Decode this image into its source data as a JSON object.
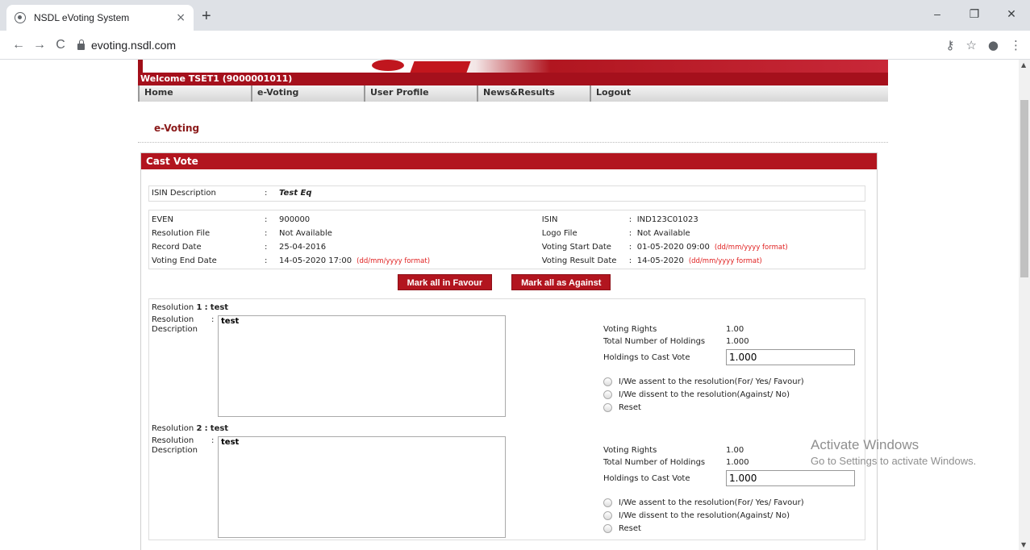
{
  "browser": {
    "tab_title": "NSDL eVoting System",
    "tab_close": "×",
    "new_tab": "+",
    "minimize": "–",
    "restore": "❐",
    "close": "✕",
    "back": "←",
    "forward": "→",
    "reload": "C",
    "url": "evoting.nsdl.com",
    "key_icon": "⚷",
    "star_icon": "☆",
    "account_icon": "●",
    "menu_icon": "⋮"
  },
  "header": {
    "welcome": "Welcome TSET1 (9000001011)",
    "menu": [
      "Home",
      "e-Voting",
      "User Profile",
      "News&Results",
      "Logout"
    ]
  },
  "section_title": "e-Voting",
  "cast_vote": {
    "title": "Cast Vote",
    "isin_description": {
      "label": "ISIN Description",
      "colon": ":",
      "value": "Test Eq"
    },
    "left": [
      {
        "label": "EVEN",
        "value": "900000",
        "fmt": ""
      },
      {
        "label": "Resolution File",
        "value": "Not Available",
        "fmt": ""
      },
      {
        "label": "Record Date",
        "value": "25-04-2016",
        "fmt": ""
      },
      {
        "label": "Voting End Date",
        "value": "14-05-2020  17:00",
        "fmt": "(dd/mm/yyyy format)"
      }
    ],
    "right": [
      {
        "label": "ISIN",
        "value": "IND123C01023",
        "fmt": ""
      },
      {
        "label": "Logo File",
        "value": "Not Available",
        "fmt": ""
      },
      {
        "label": "Voting Start Date",
        "value": "01-05-2020  09:00",
        "fmt": "(dd/mm/yyyy format)"
      },
      {
        "label": "Voting Result Date",
        "value": "14-05-2020",
        "fmt": "(dd/mm/yyyy format)"
      }
    ],
    "buttons": {
      "favour": "Mark all in Favour",
      "against": "Mark all as Against"
    },
    "resolutions": [
      {
        "title_prefix": "Resolution",
        "number": "1",
        "name": "test",
        "desc_label": "Resolution Description",
        "desc_colon": ":",
        "description": "test",
        "voting_rights_label": "Voting Rights",
        "voting_rights": "1.00",
        "total_holdings_label": "Total Number of Holdings",
        "total_holdings": "1.000",
        "holdings_cast_label": "Holdings to Cast Vote",
        "holdings_cast": "1.000",
        "options": [
          "I/We assent to the resolution(For/ Yes/ Favour)",
          "I/We dissent to the resolution(Against/ No)",
          "Reset"
        ]
      },
      {
        "title_prefix": "Resolution",
        "number": "2",
        "name": "test",
        "desc_label": "Resolution Description",
        "desc_colon": ":",
        "description": "test",
        "voting_rights_label": "Voting Rights",
        "voting_rights": "1.00",
        "total_holdings_label": "Total Number of Holdings",
        "total_holdings": "1.000",
        "holdings_cast_label": "Holdings to Cast Vote",
        "holdings_cast": "1.000",
        "options": [
          "I/We assent to the resolution(For/ Yes/ Favour)",
          "I/We dissent to the resolution(Against/ No)",
          "Reset"
        ]
      }
    ]
  },
  "watermark": {
    "line1": "Activate Windows",
    "line2": "Go to Settings to activate Windows."
  },
  "scrollbar": {
    "up": "▲",
    "down": "▼"
  },
  "colors": {
    "brand_red": "#b2151f",
    "welcome_red": "#a5101c",
    "section_title": "#8b1a1a",
    "format_hint": "#e02020"
  }
}
